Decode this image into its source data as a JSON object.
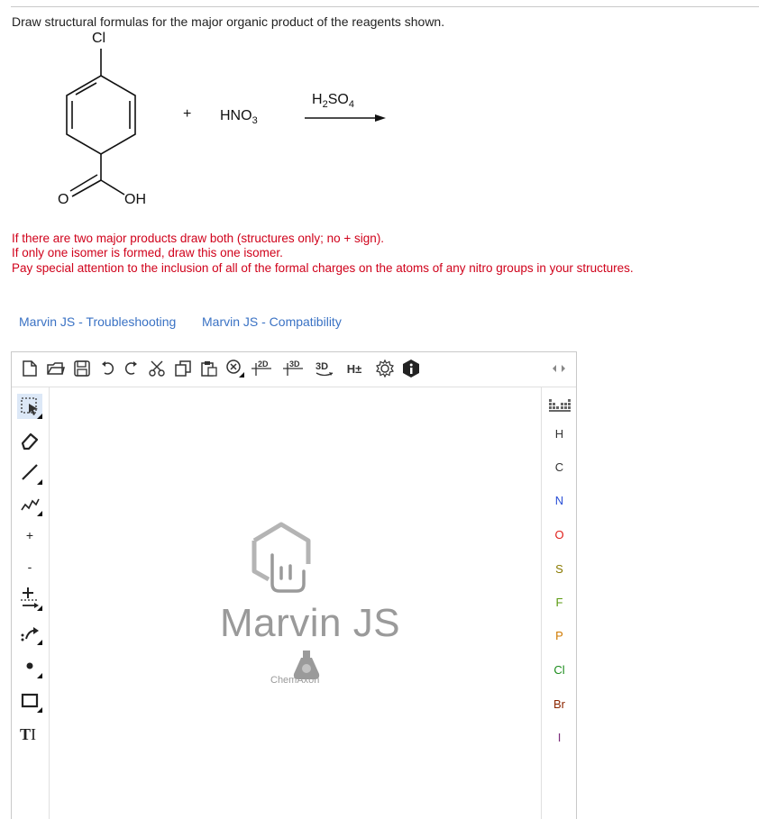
{
  "question": "Draw structural formulas for the major organic product of the reagents shown.",
  "reaction": {
    "substituent_top": "Cl",
    "substituent_bottom_o": "O",
    "substituent_bottom_oh": "OH",
    "plus": "+",
    "reagent": "HNO",
    "reagent_sub": "3",
    "catalyst_main": "H",
    "catalyst_sub1": "2",
    "catalyst_mid": "SO",
    "catalyst_sub2": "4"
  },
  "instructions": [
    "If there are two major products draw both (structures only; no + sign).",
    "If only one isomer is formed, draw this one isomer.",
    "Pay special attention to the inclusion of all of the formal charges on the atoms of any nitro groups in your structures."
  ],
  "links": {
    "troubleshooting": "Marvin JS - Troubleshooting",
    "compatibility": "Marvin JS - Compatibility"
  },
  "editor": {
    "top_toolbar": {
      "clean_2d_label": "2D",
      "clean_3d_label": "3D",
      "view_3d_label": "3D",
      "hydrogen_label": "H±"
    },
    "left_toolbar": {
      "charge_plus": "+",
      "charge_minus": "-"
    },
    "elements": [
      {
        "symbol": "H",
        "color": "#333333"
      },
      {
        "symbol": "C",
        "color": "#333333"
      },
      {
        "symbol": "N",
        "color": "#2a4fd6"
      },
      {
        "symbol": "O",
        "color": "#e0201b"
      },
      {
        "symbol": "S",
        "color": "#8a7a00"
      },
      {
        "symbol": "F",
        "color": "#5a9a10"
      },
      {
        "symbol": "P",
        "color": "#d07a00"
      },
      {
        "symbol": "Cl",
        "color": "#1c8c1c"
      },
      {
        "symbol": "Br",
        "color": "#8b2500"
      },
      {
        "symbol": "I",
        "color": "#7a2a7a"
      }
    ],
    "watermark": "Marvin JS",
    "brand": "ChemAxon"
  }
}
